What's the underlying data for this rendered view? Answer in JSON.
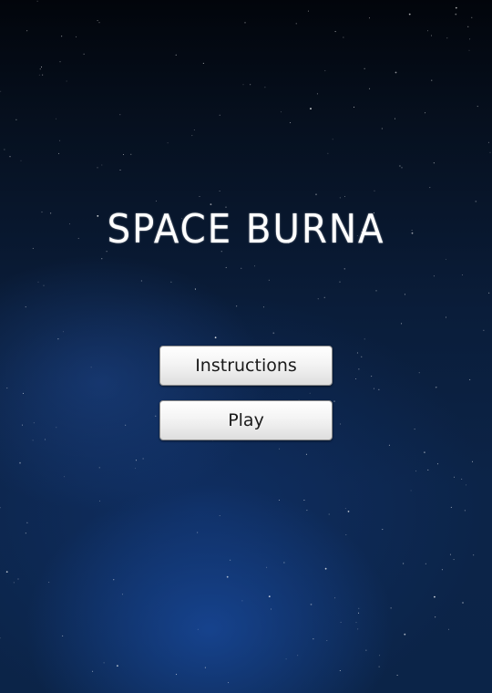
{
  "game": {
    "title": "SPACE BURNA"
  },
  "menu": {
    "instructions_label": "Instructions",
    "play_label": "Play"
  },
  "colors": {
    "background_top": "#02050b",
    "background_bottom": "#0b2448",
    "title_text": "#ffffff",
    "button_face": "#f4f4f4",
    "button_text": "#1a1a1a"
  }
}
